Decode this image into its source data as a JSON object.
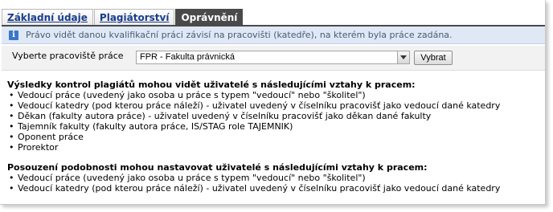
{
  "tabs": [
    {
      "label": "Základní údaje",
      "active": false
    },
    {
      "label": "Plagiátorství",
      "active": false
    },
    {
      "label": "Oprávnění",
      "active": true
    }
  ],
  "info": {
    "icon": "info-icon",
    "text": "Právo vidět danou kvalifikační práci závisí na pracovišti (katedře), na kterém byla práce zadána."
  },
  "form": {
    "label": "Vyberte pracoviště práce",
    "select_value": "FPR - Fakulta právnická",
    "button_label": "Vybrat"
  },
  "section1": {
    "heading": "Výsledky kontrol plagiátů mohou vidět uživatelé s následujícími vztahy k pracem:",
    "items": [
      "Vedoucí práce (uvedený jako osoba u práce s typem \"vedoucí\" nebo \"školitel\")",
      "Vedoucí katedry (pod kterou práce náleží) - uživatel uvedený v číselníku pracovišť jako vedoucí dané katedry",
      "Děkan (fakulty autora práce) - uživatel uvedený v číselníku pracovišť jako děkan dané fakulty",
      "Tajemník fakulty (fakulty autora práce, IS/STAG role TAJEMNIK)",
      "Oponent práce",
      "Prorektor"
    ]
  },
  "section2": {
    "heading": "Posouzení podobnosti mohou nastavovat uživatelé s následujícími vztahy k pracem:",
    "items": [
      "Vedoucí práce (uvedený jako osoba u práce s typem \"vedoucí\" nebo \"školitel\")",
      "Vedoucí katedry (pod kterou práce náleží) - uživatel uvedený v číselníku pracovišť jako vedoucí dané katedry"
    ]
  },
  "colors": {
    "tab_link": "#1a3d8c",
    "tab_active_bg": "#4a4a4a",
    "info_bg": "#dfe8f5",
    "info_text": "#4a5a74",
    "form_bg": "#f2f2f2"
  }
}
